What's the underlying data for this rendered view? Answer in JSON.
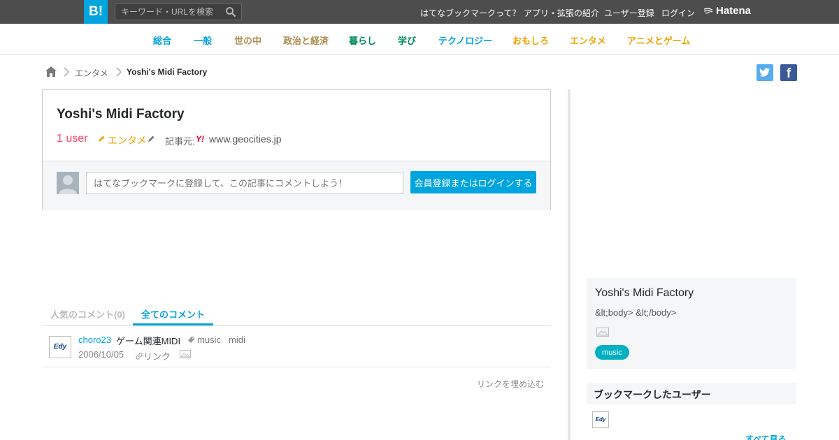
{
  "header": {
    "logo": "B!",
    "search_placeholder": "キーワード・URLを検索",
    "links": [
      "はてなブックマークって？",
      "アプリ・拡張の紹介",
      "ユーザー登録",
      "ログイン"
    ],
    "hatena": "Hatena"
  },
  "categories": [
    {
      "label": "総合",
      "color": "#00a4de"
    },
    {
      "label": "一般",
      "color": "#00a4de"
    },
    {
      "label": "世の中",
      "color": "#ad8b4f"
    },
    {
      "label": "政治と経済",
      "color": "#ad8b4f"
    },
    {
      "label": "暮らし",
      "color": "#05885b"
    },
    {
      "label": "学び",
      "color": "#05885b"
    },
    {
      "label": "テクノロジー",
      "color": "#00a4de"
    },
    {
      "label": "おもしろ",
      "color": "#f0a400"
    },
    {
      "label": "エンタメ",
      "color": "#f0a400"
    },
    {
      "label": "アニメとゲーム",
      "color": "#f0a400"
    }
  ],
  "breadcrumb": {
    "category": "エンタメ",
    "current": "Yoshi's Midi Factory"
  },
  "social": {
    "twitter": "t",
    "facebook": "f"
  },
  "entry": {
    "title": "Yoshi's Midi Factory",
    "users": "1 user",
    "category": "エンタメ",
    "source_label": "記事元:",
    "source_domain": "www.geocities.jp",
    "source_favicon": "Y!",
    "comment_placeholder": "はてなブックマークに登録して、この記事にコメントしよう！",
    "login_button": "会員登録またはログインする"
  },
  "tabs": {
    "popular": "人気のコメント(0)",
    "all": "全てのコメント"
  },
  "bookmarks": [
    {
      "user": "choro23",
      "comment": "ゲーム関連MIDI",
      "tags": [
        "music",
        "midi"
      ],
      "date": "2006/10/05",
      "link": "リンク",
      "avatar_text": "Edy"
    }
  ],
  "embed_link": "リンクを埋め込む",
  "sidebar": {
    "title": "Yoshi's Midi Factory",
    "description": "&lt;body> &lt;/body>",
    "tag": "music",
    "users_heading": "ブックマークしたユーザー",
    "more": "すべて見る"
  }
}
